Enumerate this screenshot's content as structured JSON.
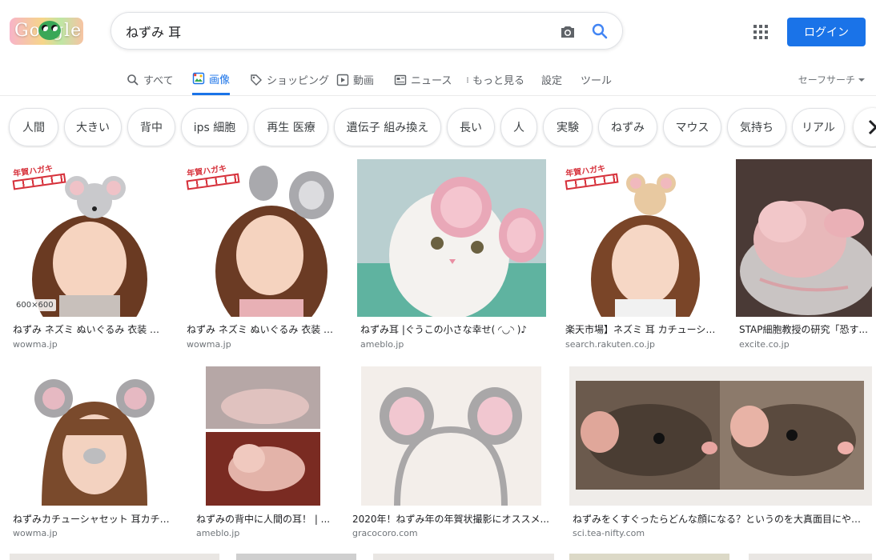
{
  "logo": {
    "text": "Google"
  },
  "search": {
    "query": "ねずみ 耳",
    "camera_icon": "camera-icon",
    "search_icon": "search-icon"
  },
  "header": {
    "login_label": "ログイン",
    "apps_icon": "apps-grid-icon",
    "accent": "#1a73e8"
  },
  "tabs": [
    {
      "label": "すべて",
      "icon": "search-icon",
      "active": false
    },
    {
      "label": "画像",
      "icon": "image-icon",
      "active": true
    },
    {
      "label": "ショッピング",
      "icon": "tag-icon",
      "active": false
    },
    {
      "label": "動画",
      "icon": "play-icon",
      "active": false
    },
    {
      "label": "ニュース",
      "icon": "news-icon",
      "active": false
    },
    {
      "label": "もっと見る",
      "icon": "more-vert-icon",
      "active": false
    },
    {
      "label": "設定",
      "active": false
    },
    {
      "label": "ツール",
      "active": false
    }
  ],
  "safesearch": {
    "label": "セーフサーチ"
  },
  "chips": [
    "人間",
    "大きい",
    "背中",
    "ips 細胞",
    "再生 医療",
    "遺伝子 組み換え",
    "長い",
    "人",
    "実験",
    "ねずみ",
    "マウス",
    "気持ち",
    "リアル"
  ],
  "results": [
    {
      "caption": "ねずみ ネズミ ぬいぐるみ 衣装 仮...",
      "source": "wowma.jp",
      "size": "600×600",
      "stamp": "年賀ハガキ"
    },
    {
      "caption": "ねずみ ネズミ ぬいぐるみ 衣装 仮...",
      "source": "wowma.jp",
      "stamp": "年賀ハガキ"
    },
    {
      "caption": "ねずみ耳 |ぐうこの小さな幸せ( ◜◡◝ )♪",
      "source": "ameblo.jp"
    },
    {
      "caption": "楽天市場】ネズミ 耳 カチューシャ...",
      "source": "search.rakuten.co.jp",
      "stamp": "年賀ハガキ"
    },
    {
      "caption": "STAP細胞教授の研究「恐す...",
      "source": "excite.co.jp"
    },
    {
      "caption": "ねずみカチューシャセット 耳カチュ...",
      "source": "wowma.jp"
    },
    {
      "caption": "ねずみの背中に人間の耳！ | ...",
      "source": "ameblo.jp"
    },
    {
      "caption": "2020年！ねずみ年の年賀状撮影にオススメ...",
      "source": "gracocoro.com"
    },
    {
      "caption": "ねずみをくすぐったらどんな顔になる？というのを大真面目にやっ ...",
      "source": "sci.tea-nifty.com"
    }
  ]
}
